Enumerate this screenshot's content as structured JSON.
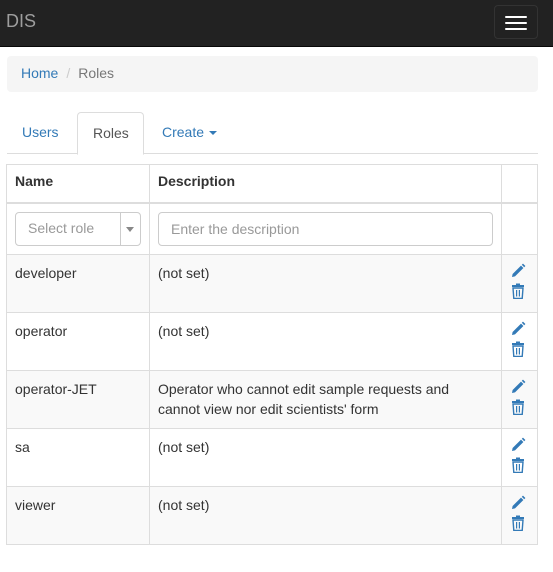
{
  "navbar": {
    "brand": "DIS"
  },
  "breadcrumb": {
    "home": "Home",
    "separator": "/",
    "current": "Roles"
  },
  "tabs": {
    "users": "Users",
    "roles": "Roles",
    "create": "Create"
  },
  "table": {
    "headers": {
      "name": "Name",
      "description": "Description"
    },
    "filters": {
      "role_placeholder": "Select role",
      "description_placeholder": "Enter the description"
    },
    "rows": [
      {
        "name": "developer",
        "description": "(not set)"
      },
      {
        "name": "operator",
        "description": "(not set)"
      },
      {
        "name": "operator-JET",
        "description": "Operator who cannot edit sample requests and cannot view nor edit scientists' form"
      },
      {
        "name": "sa",
        "description": "(not set)"
      },
      {
        "name": "viewer",
        "description": "(not set)"
      }
    ],
    "row_actions": [
      "pencil-icon",
      "trash-icon"
    ]
  },
  "colors": {
    "link": "#337ab7",
    "navbar": "#222222",
    "stripe": "#f9f9f9"
  }
}
